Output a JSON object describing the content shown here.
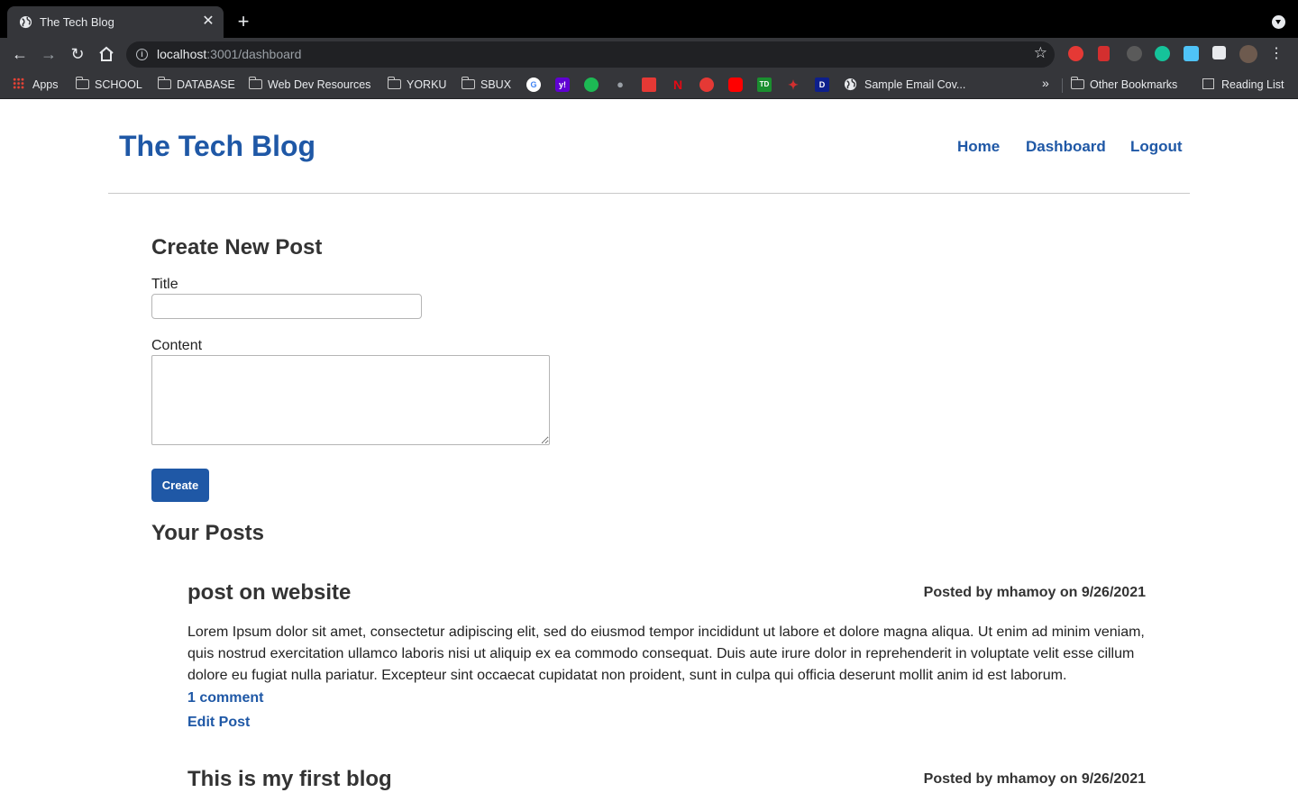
{
  "browser": {
    "tab_title": "The Tech Blog",
    "url_host": "localhost",
    "url_path": ":3001/dashboard",
    "bookmarks": [
      {
        "label": "Apps"
      },
      {
        "label": "SCHOOL"
      },
      {
        "label": "DATABASE"
      },
      {
        "label": "Web Dev Resources"
      },
      {
        "label": "YORKU"
      },
      {
        "label": "SBUX"
      },
      {
        "label": "Sample Email Cov..."
      },
      {
        "label": "Other Bookmarks"
      },
      {
        "label": "Reading List"
      }
    ],
    "extensions": [
      "abp-icon",
      "bookmark-icon",
      "extension-icon",
      "grammarly-icon",
      "cloud-icon",
      "puzzle-icon",
      "profile-avatar"
    ]
  },
  "site": {
    "title": "The Tech Blog",
    "nav": {
      "home": "Home",
      "dashboard": "Dashboard",
      "logout": "Logout"
    }
  },
  "create_post": {
    "heading": "Create New Post",
    "title_label": "Title",
    "content_label": "Content",
    "title_value": "",
    "content_value": "",
    "button": "Create"
  },
  "your_posts": {
    "heading": "Your Posts",
    "posts": [
      {
        "title": "post on website",
        "meta": "Posted by mhamoy on 9/26/2021",
        "body": "Lorem Ipsum dolor sit amet, consectetur adipiscing elit, sed do eiusmod tempor incididunt ut labore et dolore magna aliqua. Ut enim ad minim veniam, quis nostrud exercitation ullamco laboris nisi ut aliquip ex ea commodo consequat. Duis aute irure dolor in reprehenderit in voluptate velit esse cillum dolore eu fugiat nulla pariatur. Excepteur sint occaecat cupidatat non proident, sunt in culpa qui officia deserunt mollit anim id est laborum.",
        "comments": "1 comment",
        "edit": "Edit Post"
      },
      {
        "title": "This is my first blog",
        "meta": "Posted by mhamoy on 9/26/2021"
      }
    ]
  }
}
